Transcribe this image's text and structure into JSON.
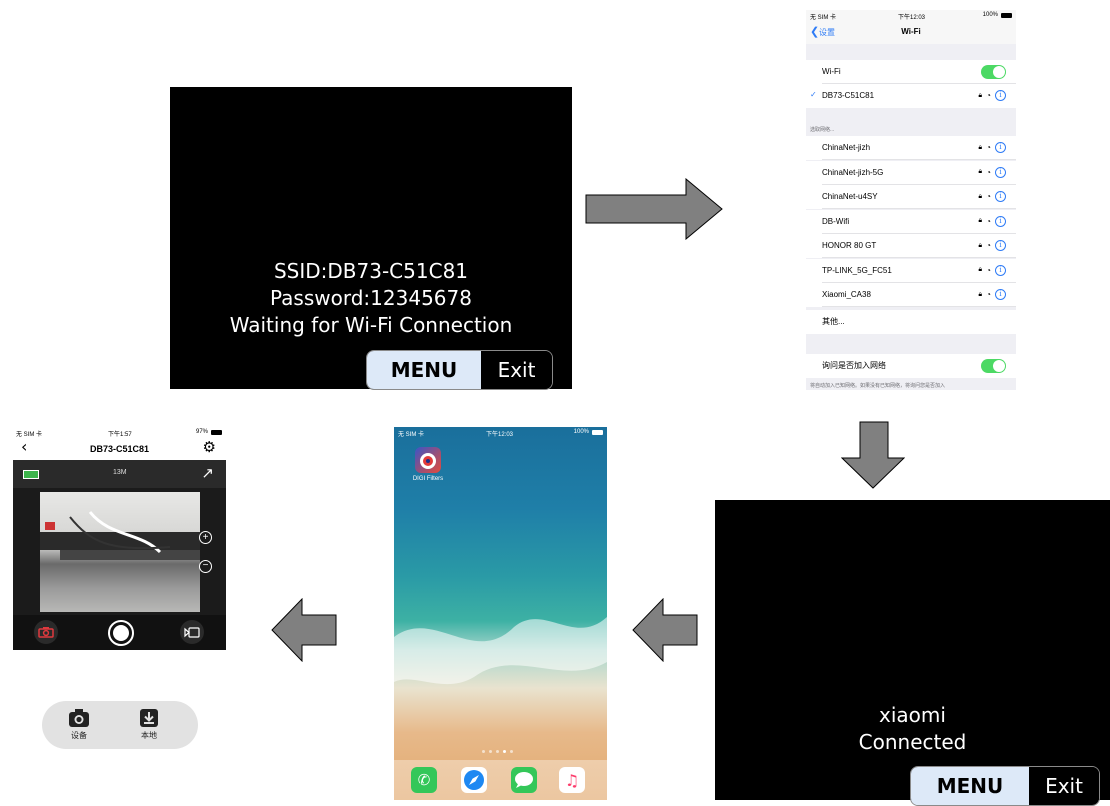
{
  "camera_setup": {
    "ssid": "SSID:DB73-C51C81",
    "password": "Password:12345678",
    "waiting": "Waiting for Wi-Fi Connection",
    "menu": "MENU",
    "exit": "Exit"
  },
  "camera_connected": {
    "network": "xiaomi",
    "status": "Connected",
    "menu": "MENU",
    "exit": "Exit"
  },
  "wifi_settings": {
    "status_left": "无 SIM 卡",
    "status_time": "下午12:03",
    "status_battery": "100%",
    "back_label": "设置",
    "title": "Wi-Fi",
    "wifi_toggle_label": "Wi-Fi",
    "wifi_on": true,
    "connected_network": "DB73-C51C81",
    "section_header": "选取网络...",
    "networks": [
      "ChinaNet-jizh",
      "ChinaNet-jizh-5G",
      "ChinaNet-u4SY",
      "DB-Wifi",
      "HONOR 80 GT",
      "TP-LINK_5G_FC51",
      "Xiaomi_CA38"
    ],
    "other": "其他...",
    "ask_join_label": "询问是否加入网络",
    "ask_join_on": true,
    "footnote": "将自动加入已知网络。如果没有已知网络，将询问您是否加入"
  },
  "home_screen": {
    "status_left": "无 SIM 卡",
    "status_time": "下午12:03",
    "status_battery": "100%",
    "app_label": "DIGI Filters",
    "dock_icons": [
      "phone-icon",
      "safari-icon",
      "messages-icon",
      "music-icon"
    ]
  },
  "camera_app": {
    "status_left": "无 SIM 卡",
    "status_time": "下午1:57",
    "status_battery": "97%",
    "title": "DB73-C51C81",
    "resolution": "13M",
    "tabs": [
      {
        "label": "设备",
        "icon": "camera-tab-icon"
      },
      {
        "label": "本地",
        "icon": "download-icon"
      }
    ]
  },
  "colors": {
    "ios_blue": "#2f7cf6",
    "toggle_green": "#4cd964",
    "arrow_gray": "#808080",
    "menu_highlight": "#dde9f8",
    "record_red": "#e0393e"
  }
}
